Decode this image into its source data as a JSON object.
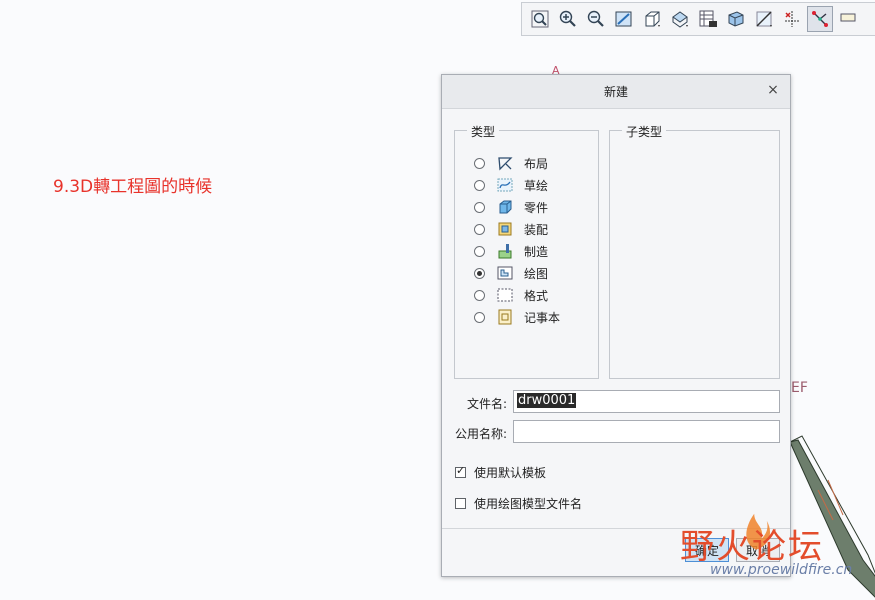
{
  "caption": "9.3D轉工程圖的時候",
  "background": {
    "mark_a": "A",
    "mark_ef": "EF"
  },
  "toolbar": {
    "buttons": [
      {
        "icon": "zoom-fit-icon"
      },
      {
        "icon": "zoom-in-icon"
      },
      {
        "icon": "zoom-out-icon"
      },
      {
        "icon": "repaint-icon"
      },
      {
        "icon": "view-cube-icon"
      },
      {
        "icon": "saved-views-icon"
      },
      {
        "icon": "view-manager-icon"
      },
      {
        "icon": "display-style-icon"
      },
      {
        "icon": "datum-display-icon"
      },
      {
        "icon": "spin-center-icon"
      },
      {
        "icon": "sketch-display-icon",
        "active": true
      },
      {
        "icon": "annotation-display-icon"
      }
    ]
  },
  "dialog": {
    "title": "新建",
    "close": "×",
    "type_group": "类型",
    "subtype_group": "子类型",
    "types": [
      {
        "label": "布局",
        "icon": "layout-icon",
        "checked": false
      },
      {
        "label": "草绘",
        "icon": "sketch-icon",
        "checked": false
      },
      {
        "label": "零件",
        "icon": "part-icon",
        "checked": false
      },
      {
        "label": "装配",
        "icon": "assembly-icon",
        "checked": false
      },
      {
        "label": "制造",
        "icon": "manufacturing-icon",
        "checked": false
      },
      {
        "label": "绘图",
        "icon": "drawing-icon",
        "checked": true
      },
      {
        "label": "格式",
        "icon": "format-icon",
        "checked": false
      },
      {
        "label": "记事本",
        "icon": "notebook-icon",
        "checked": false
      }
    ],
    "filename_label": "文件名:",
    "filename_value": "drw0001",
    "common_name_label": "公用名称:",
    "common_name_value": "",
    "use_default_template": {
      "label": "使用默认模板",
      "checked": true
    },
    "use_drawing_model_name": {
      "label": "使用绘图模型文件名",
      "checked": false
    },
    "ok_label": "确定",
    "cancel_label": "取消"
  },
  "watermark": {
    "text_main": "野火论坛",
    "url": "www.proewildfire.cn"
  }
}
